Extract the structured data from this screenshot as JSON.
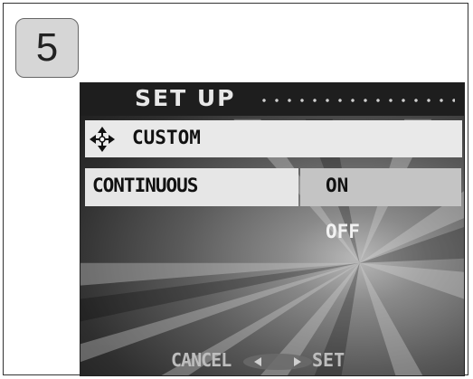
{
  "step": {
    "number": "5"
  },
  "screen": {
    "title": "SET UP",
    "custom_row": {
      "icon": "four-way-arrow-icon",
      "label": "CUSTOM"
    },
    "setting_row": {
      "label": "CONTINUOUS"
    },
    "options": [
      {
        "label": "ON",
        "selected": true
      },
      {
        "label": "OFF",
        "selected": false
      }
    ],
    "footer": {
      "cancel_label": "CANCEL",
      "set_label": "SET",
      "left_icon": "left-arrow-icon",
      "right_icon": "right-arrow-icon"
    },
    "colors": {
      "highlight": "#e9e9e9",
      "selected_option": "#c4c4c4",
      "screen_dark": "#1e1e1e"
    }
  }
}
